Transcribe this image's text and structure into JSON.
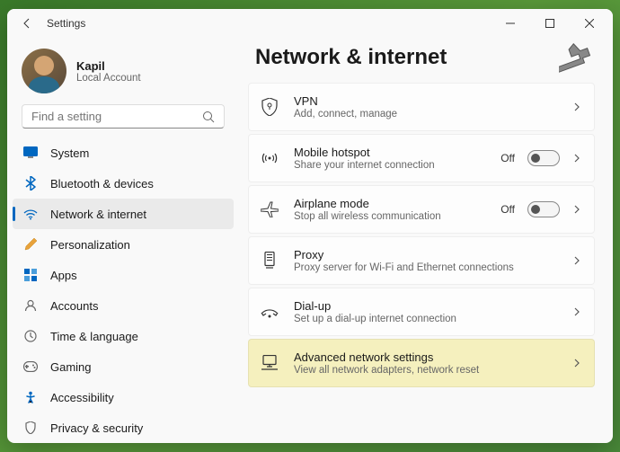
{
  "window": {
    "title": "Settings"
  },
  "profile": {
    "name": "Kapil",
    "subtitle": "Local Account"
  },
  "search": {
    "placeholder": "Find a setting"
  },
  "nav": {
    "items": [
      {
        "icon": "system",
        "label": "System"
      },
      {
        "icon": "bluetooth",
        "label": "Bluetooth & devices"
      },
      {
        "icon": "network",
        "label": "Network & internet"
      },
      {
        "icon": "personalization",
        "label": "Personalization"
      },
      {
        "icon": "apps",
        "label": "Apps"
      },
      {
        "icon": "accounts",
        "label": "Accounts"
      },
      {
        "icon": "time",
        "label": "Time & language"
      },
      {
        "icon": "gaming",
        "label": "Gaming"
      },
      {
        "icon": "accessibility",
        "label": "Accessibility"
      },
      {
        "icon": "privacy",
        "label": "Privacy & security"
      }
    ]
  },
  "main": {
    "title": "Network & internet",
    "items": [
      {
        "title": "VPN",
        "subtitle": "Add, connect, manage",
        "toggle": null
      },
      {
        "title": "Mobile hotspot",
        "subtitle": "Share your internet connection",
        "toggle": "Off"
      },
      {
        "title": "Airplane mode",
        "subtitle": "Stop all wireless communication",
        "toggle": "Off"
      },
      {
        "title": "Proxy",
        "subtitle": "Proxy server for Wi-Fi and Ethernet connections",
        "toggle": null
      },
      {
        "title": "Dial-up",
        "subtitle": "Set up a dial-up internet connection",
        "toggle": null
      },
      {
        "title": "Advanced network settings",
        "subtitle": "View all network adapters, network reset",
        "toggle": null,
        "highlighted": true
      }
    ]
  }
}
